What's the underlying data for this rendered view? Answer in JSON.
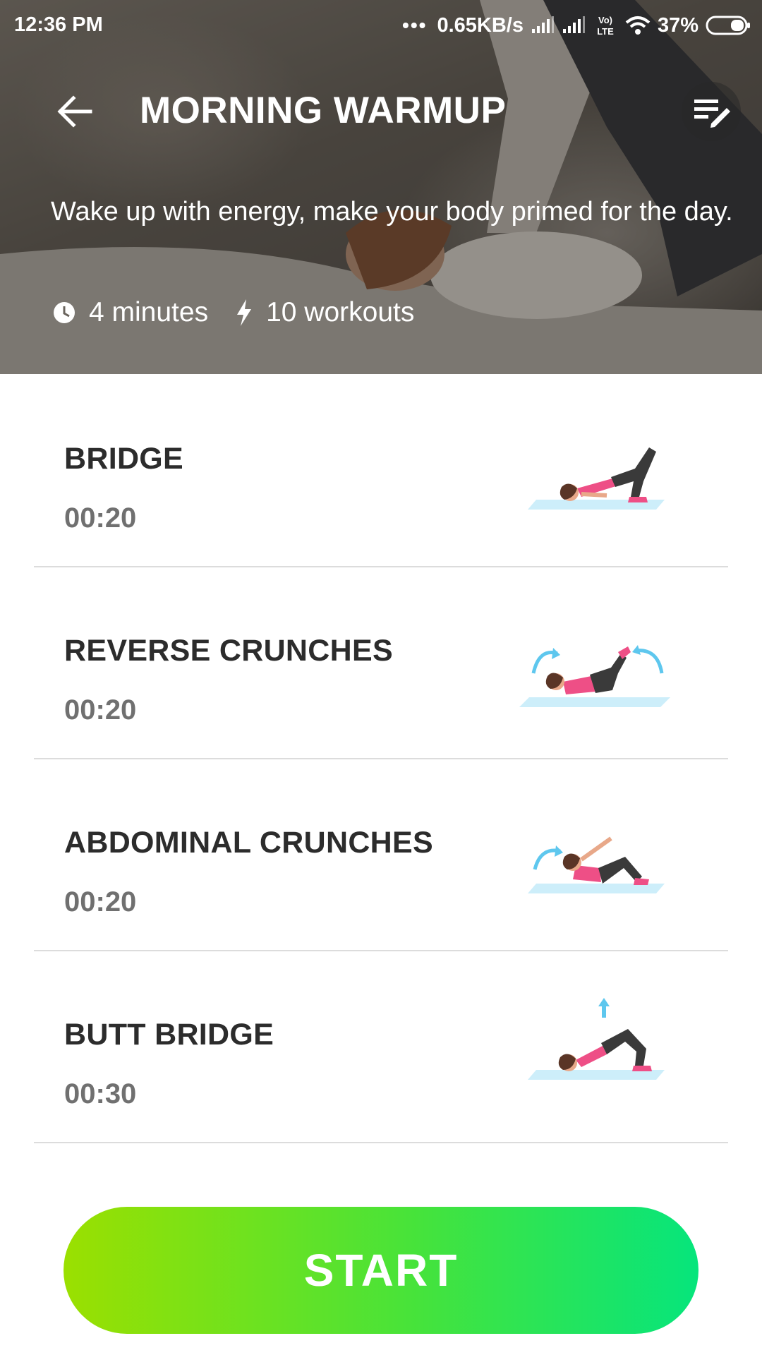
{
  "status_bar": {
    "time": "12:36 PM",
    "network_speed": "0.65KB/s",
    "volte_label": "Vo) LTE",
    "battery": "37%",
    "icons": [
      "more-dots-icon",
      "signal-icon",
      "signal-icon",
      "volte-icon",
      "wifi-icon",
      "battery-icon"
    ]
  },
  "header": {
    "title": "MORNING WARMUP",
    "back_icon": "arrow-left-icon",
    "edit_icon": "edit-list-icon"
  },
  "hero": {
    "description": "Wake up with energy, make your body primed for the day.",
    "duration": "4 minutes",
    "workouts": "10 workouts",
    "duration_icon": "clock-icon",
    "workouts_icon": "lightning-icon"
  },
  "exercises": [
    {
      "name": "BRIDGE",
      "duration": "00:20",
      "illustration": "bridge-pose"
    },
    {
      "name": "REVERSE CRUNCHES",
      "duration": "00:20",
      "illustration": "reverse-crunch-pose"
    },
    {
      "name": "ABDOMINAL CRUNCHES",
      "duration": "00:20",
      "illustration": "abdominal-crunch-pose"
    },
    {
      "name": "BUTT BRIDGE",
      "duration": "00:30",
      "illustration": "butt-bridge-pose"
    }
  ],
  "start_button": {
    "label": "START"
  },
  "colors": {
    "accent_start": "#9be000",
    "accent_end": "#06e57c",
    "exercise_name": "#2c2c2c",
    "duration_text": "#707070",
    "outfit_pink": "#ee4f86",
    "pants_dark": "#3a3a3a",
    "mat_blue": "#cdeefa",
    "arrow_blue": "#5ec7ee"
  }
}
